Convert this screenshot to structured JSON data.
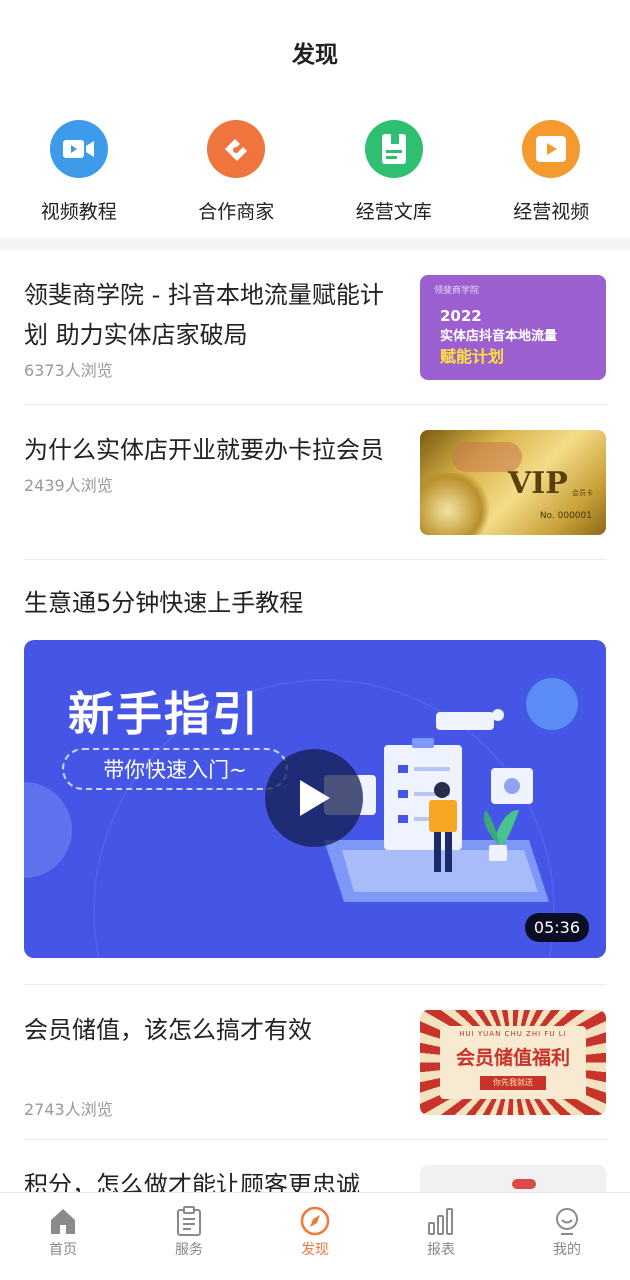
{
  "header": {
    "title": "发现"
  },
  "quick_nav": [
    {
      "label": "视频教程",
      "icon": "video-camera-icon",
      "color": "#3d9be9"
    },
    {
      "label": "合作商家",
      "icon": "handshake-icon",
      "color": "#f0743d"
    },
    {
      "label": "经营文库",
      "icon": "document-icon",
      "color": "#2fbf71"
    },
    {
      "label": "经营视频",
      "icon": "play-square-icon",
      "color": "#f59a2f"
    }
  ],
  "articles": [
    {
      "title": "领斐商学院 - 抖音本地流量赋能计划 助力实体店家破局",
      "views": "6373人浏览",
      "thumb": {
        "brand": "领斐商学院",
        "year": "2022",
        "line1": "实体店抖音本地流量",
        "line2": "赋能计划",
        "bg": "#9b5fd0"
      }
    },
    {
      "title": "为什么实体店开业就要办卡拉会员",
      "views": "2439人浏览",
      "thumb": {
        "vip": "VIP",
        "small": "会员卡",
        "no": "No. 000001"
      }
    }
  ],
  "video": {
    "section_title": "生意通5分钟快速上手教程",
    "headline": "新手指引",
    "subline": "带你快速入门~",
    "duration": "05:36"
  },
  "articles2": [
    {
      "title": "会员储值，该怎么搞才有效",
      "views": "2743人浏览",
      "thumb": {
        "pinyin": "HUI YUAN CHU ZHI FU LI",
        "main": "会员储值福利",
        "sub": "你先我就送"
      }
    },
    {
      "title": "积分，怎么做才能让顾客更忠诚"
    }
  ],
  "tabbar": [
    {
      "label": "首页",
      "icon": "home-icon",
      "active": false
    },
    {
      "label": "服务",
      "icon": "clipboard-icon",
      "active": false
    },
    {
      "label": "发现",
      "icon": "compass-icon",
      "active": true
    },
    {
      "label": "报表",
      "icon": "bar-chart-icon",
      "active": false
    },
    {
      "label": "我的",
      "icon": "user-icon",
      "active": false
    }
  ],
  "colors": {
    "accent": "#f07a3a",
    "muted": "#999999"
  }
}
